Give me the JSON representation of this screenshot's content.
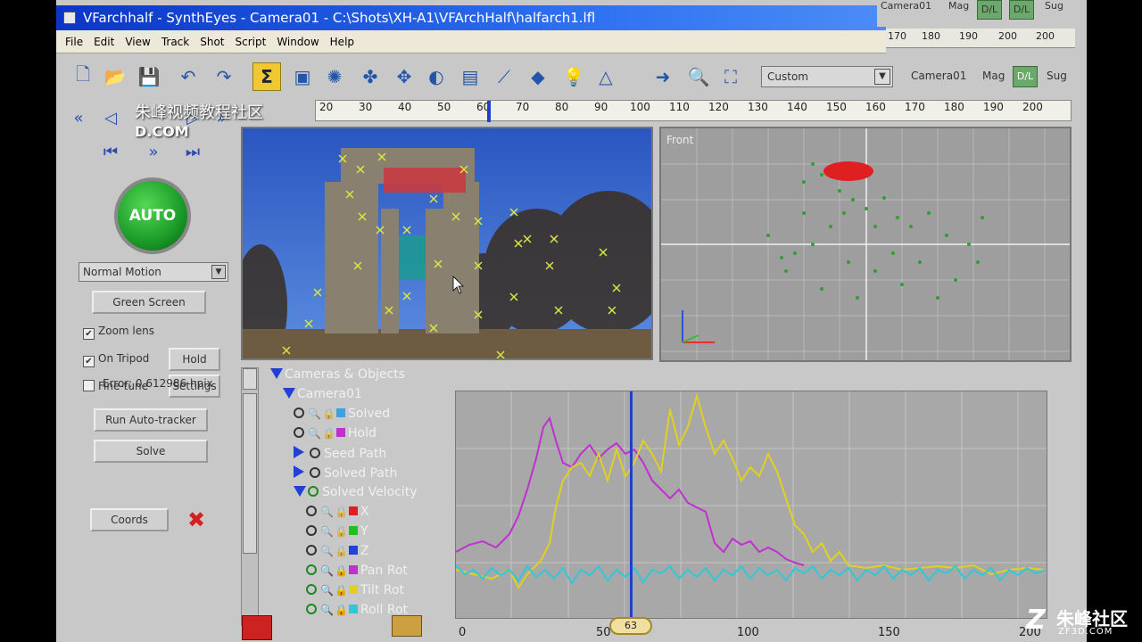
{
  "window": {
    "title": "VFarchhalf - SynthEyes - Camera01 - C:\\Shots\\XH-A1\\VFArchHalf\\halfarch1.lfl"
  },
  "menu": [
    "File",
    "Edit",
    "View",
    "Track",
    "Shot",
    "Script",
    "Window",
    "Help"
  ],
  "top_strip": {
    "camera": "Camera01",
    "mag": "Mag",
    "dl1": "D/L",
    "dl2": "D/L",
    "sug": "Sug"
  },
  "top_ruler_ticks": [
    "170",
    "180",
    "190",
    "200",
    "200"
  ],
  "toolbar": {
    "icons": [
      "new-file-icon",
      "open-folder-icon",
      "save-icon",
      "undo-icon",
      "redo-icon",
      "summary-icon",
      "camera-panel-icon",
      "feature-panel-icon",
      "tracker-panel-icon",
      "coordinate-panel-icon",
      "lens-panel-icon",
      "solver-panel-icon",
      "graph-panel-icon",
      "3d-panel-icon",
      "lighting-panel-icon",
      "shot-panel-icon",
      "arrow-right-icon",
      "zoom-icon",
      "fit-icon"
    ],
    "select_value": "Custom",
    "camera": "Camera01",
    "mag": "Mag",
    "dl": "D/L",
    "sug": "Sug"
  },
  "frame_ruler": {
    "ticks": [
      "20",
      "30",
      "40",
      "50",
      "60",
      "70",
      "80",
      "90",
      "100",
      "110",
      "120",
      "130",
      "140",
      "150",
      "160",
      "170",
      "180",
      "190",
      "200"
    ],
    "current_frame": 63
  },
  "watermark": {
    "line1": "朱峰视频教程社区",
    "line2": "D.COM"
  },
  "left_panel": {
    "auto_label": "AUTO",
    "motion_select": "Normal Motion",
    "green_screen": "Green Screen",
    "zoom_lens": "Zoom lens",
    "zoom_lens_checked": true,
    "on_tripod": "On Tripod",
    "on_tripod_checked": true,
    "hold": "Hold",
    "fine_tune": "Fine-tune",
    "fine_tune_checked": false,
    "settings": "Settings",
    "run_autotracker": "Run Auto-tracker",
    "solve": "Solve",
    "error": "Error: 0.612986 hpix",
    "coords": "Coords"
  },
  "perspective": {
    "view_label": "Front"
  },
  "tree": {
    "root": "Cameras & Objects",
    "camera": "Camera01",
    "solved": "Solved",
    "hold": "Hold",
    "seed_path": "Seed Path",
    "solved_path": "Solved Path",
    "solved_velocity": "Solved Velocity",
    "x": "X",
    "y": "Y",
    "z": "Z",
    "pan_rot": "Pan Rot",
    "tilt_rot": "Tilt Rot",
    "roll_rot": "Roll Rot"
  },
  "colors": {
    "solved": "#3fa0e0",
    "hold": "#c030d0",
    "x": "#e02020",
    "y": "#20c020",
    "z": "#2040e0",
    "pan": "#c030d0",
    "tilt": "#e0d020",
    "roll": "#30c8d8"
  },
  "graph": {
    "axis_ticks": [
      "0",
      "50",
      "100",
      "150",
      "200"
    ],
    "frame_knob": "63"
  },
  "site_mark": {
    "big": "朱峰社区",
    "small": "ZF3D.COM"
  }
}
